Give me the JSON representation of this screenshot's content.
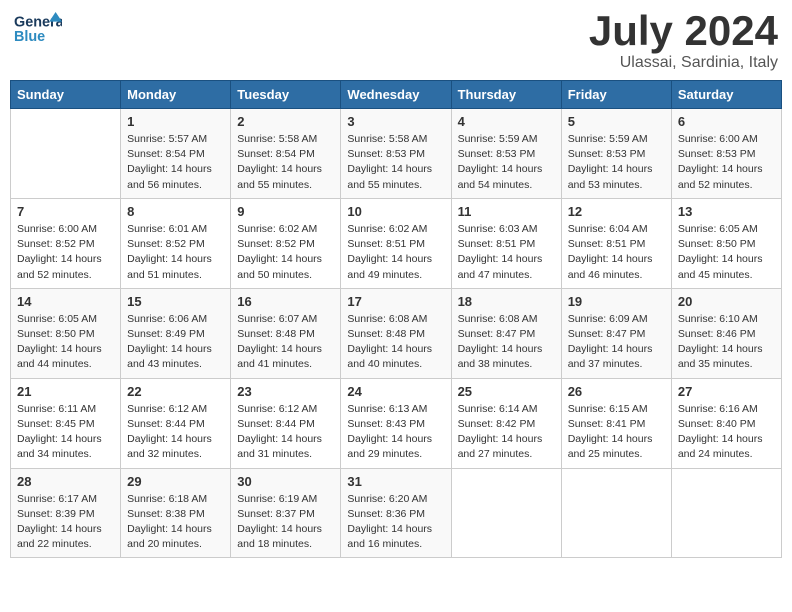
{
  "logo": {
    "line1": "General",
    "line2": "Blue"
  },
  "title": {
    "main": "July 2024",
    "sub": "Ulassai, Sardinia, Italy"
  },
  "days_header": [
    "Sunday",
    "Monday",
    "Tuesday",
    "Wednesday",
    "Thursday",
    "Friday",
    "Saturday"
  ],
  "weeks": [
    [
      {
        "day": "",
        "detail": ""
      },
      {
        "day": "1",
        "detail": "Sunrise: 5:57 AM\nSunset: 8:54 PM\nDaylight: 14 hours\nand 56 minutes."
      },
      {
        "day": "2",
        "detail": "Sunrise: 5:58 AM\nSunset: 8:54 PM\nDaylight: 14 hours\nand 55 minutes."
      },
      {
        "day": "3",
        "detail": "Sunrise: 5:58 AM\nSunset: 8:53 PM\nDaylight: 14 hours\nand 55 minutes."
      },
      {
        "day": "4",
        "detail": "Sunrise: 5:59 AM\nSunset: 8:53 PM\nDaylight: 14 hours\nand 54 minutes."
      },
      {
        "day": "5",
        "detail": "Sunrise: 5:59 AM\nSunset: 8:53 PM\nDaylight: 14 hours\nand 53 minutes."
      },
      {
        "day": "6",
        "detail": "Sunrise: 6:00 AM\nSunset: 8:53 PM\nDaylight: 14 hours\nand 52 minutes."
      }
    ],
    [
      {
        "day": "7",
        "detail": "Sunrise: 6:00 AM\nSunset: 8:52 PM\nDaylight: 14 hours\nand 52 minutes."
      },
      {
        "day": "8",
        "detail": "Sunrise: 6:01 AM\nSunset: 8:52 PM\nDaylight: 14 hours\nand 51 minutes."
      },
      {
        "day": "9",
        "detail": "Sunrise: 6:02 AM\nSunset: 8:52 PM\nDaylight: 14 hours\nand 50 minutes."
      },
      {
        "day": "10",
        "detail": "Sunrise: 6:02 AM\nSunset: 8:51 PM\nDaylight: 14 hours\nand 49 minutes."
      },
      {
        "day": "11",
        "detail": "Sunrise: 6:03 AM\nSunset: 8:51 PM\nDaylight: 14 hours\nand 47 minutes."
      },
      {
        "day": "12",
        "detail": "Sunrise: 6:04 AM\nSunset: 8:51 PM\nDaylight: 14 hours\nand 46 minutes."
      },
      {
        "day": "13",
        "detail": "Sunrise: 6:05 AM\nSunset: 8:50 PM\nDaylight: 14 hours\nand 45 minutes."
      }
    ],
    [
      {
        "day": "14",
        "detail": "Sunrise: 6:05 AM\nSunset: 8:50 PM\nDaylight: 14 hours\nand 44 minutes."
      },
      {
        "day": "15",
        "detail": "Sunrise: 6:06 AM\nSunset: 8:49 PM\nDaylight: 14 hours\nand 43 minutes."
      },
      {
        "day": "16",
        "detail": "Sunrise: 6:07 AM\nSunset: 8:48 PM\nDaylight: 14 hours\nand 41 minutes."
      },
      {
        "day": "17",
        "detail": "Sunrise: 6:08 AM\nSunset: 8:48 PM\nDaylight: 14 hours\nand 40 minutes."
      },
      {
        "day": "18",
        "detail": "Sunrise: 6:08 AM\nSunset: 8:47 PM\nDaylight: 14 hours\nand 38 minutes."
      },
      {
        "day": "19",
        "detail": "Sunrise: 6:09 AM\nSunset: 8:47 PM\nDaylight: 14 hours\nand 37 minutes."
      },
      {
        "day": "20",
        "detail": "Sunrise: 6:10 AM\nSunset: 8:46 PM\nDaylight: 14 hours\nand 35 minutes."
      }
    ],
    [
      {
        "day": "21",
        "detail": "Sunrise: 6:11 AM\nSunset: 8:45 PM\nDaylight: 14 hours\nand 34 minutes."
      },
      {
        "day": "22",
        "detail": "Sunrise: 6:12 AM\nSunset: 8:44 PM\nDaylight: 14 hours\nand 32 minutes."
      },
      {
        "day": "23",
        "detail": "Sunrise: 6:12 AM\nSunset: 8:44 PM\nDaylight: 14 hours\nand 31 minutes."
      },
      {
        "day": "24",
        "detail": "Sunrise: 6:13 AM\nSunset: 8:43 PM\nDaylight: 14 hours\nand 29 minutes."
      },
      {
        "day": "25",
        "detail": "Sunrise: 6:14 AM\nSunset: 8:42 PM\nDaylight: 14 hours\nand 27 minutes."
      },
      {
        "day": "26",
        "detail": "Sunrise: 6:15 AM\nSunset: 8:41 PM\nDaylight: 14 hours\nand 25 minutes."
      },
      {
        "day": "27",
        "detail": "Sunrise: 6:16 AM\nSunset: 8:40 PM\nDaylight: 14 hours\nand 24 minutes."
      }
    ],
    [
      {
        "day": "28",
        "detail": "Sunrise: 6:17 AM\nSunset: 8:39 PM\nDaylight: 14 hours\nand 22 minutes."
      },
      {
        "day": "29",
        "detail": "Sunrise: 6:18 AM\nSunset: 8:38 PM\nDaylight: 14 hours\nand 20 minutes."
      },
      {
        "day": "30",
        "detail": "Sunrise: 6:19 AM\nSunset: 8:37 PM\nDaylight: 14 hours\nand 18 minutes."
      },
      {
        "day": "31",
        "detail": "Sunrise: 6:20 AM\nSunset: 8:36 PM\nDaylight: 14 hours\nand 16 minutes."
      },
      {
        "day": "",
        "detail": ""
      },
      {
        "day": "",
        "detail": ""
      },
      {
        "day": "",
        "detail": ""
      }
    ]
  ]
}
